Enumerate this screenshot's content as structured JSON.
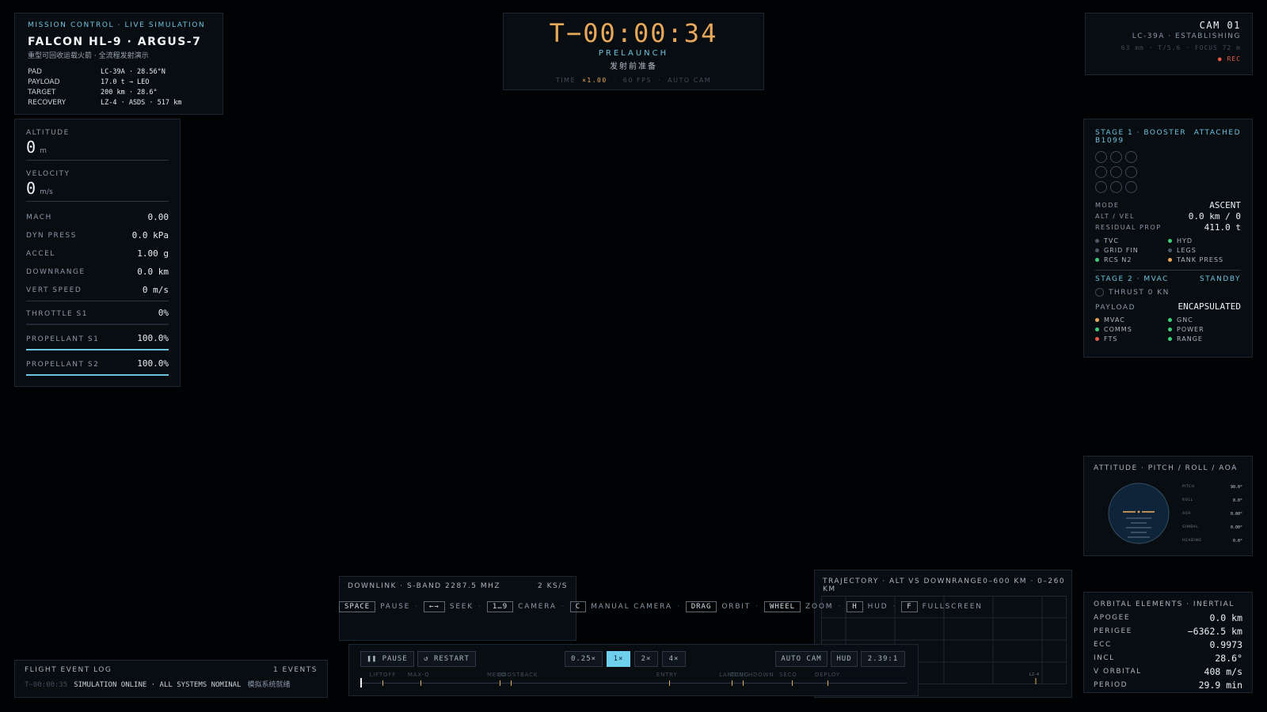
{
  "mission": {
    "header": "MISSION CONTROL · LIVE SIMULATION",
    "title": "FALCON HL-9 · ARGUS-7",
    "subtitle": "重型可回收运载火箭 · 全流程发射演示",
    "rows": [
      {
        "k": "PAD",
        "v": "LC-39A · 28.56°N"
      },
      {
        "k": "PAYLOAD",
        "v": "17.0 t → LEO"
      },
      {
        "k": "TARGET",
        "v": "200 km · 28.6°"
      },
      {
        "k": "RECOVERY",
        "v": "LZ-4 · ASDS · 517 km"
      }
    ]
  },
  "telemetry": {
    "altitude_label": "ALTITUDE",
    "altitude_value": "0",
    "altitude_unit": "m",
    "velocity_label": "VELOCITY",
    "velocity_value": "0",
    "velocity_unit": "m/s",
    "rows": [
      {
        "k": "MACH",
        "v": "0.00"
      },
      {
        "k": "DYN PRESS",
        "v": "0.0 kPa"
      },
      {
        "k": "ACCEL",
        "v": "1.00 g"
      },
      {
        "k": "DOWNRANGE",
        "v": "0.0 km"
      },
      {
        "k": "VERT SPEED",
        "v": "0 m/s"
      }
    ],
    "throttle_label": "THROTTLE S1",
    "throttle_value": "0%",
    "prop1_label": "PROPELLANT S1",
    "prop1_value": "100.0%",
    "prop1_level": 1.0,
    "prop2_label": "PROPELLANT S2",
    "prop2_value": "100.0%",
    "prop2_level": 1.0
  },
  "clock": {
    "time": "T−00:00:34",
    "phase": "PRELAUNCH",
    "phase_cn": "发射前准备",
    "time_label": "TIME",
    "time_scale": "×1.00",
    "fps": "60 FPS",
    "cam_mode": "AUTO CAM"
  },
  "camera": {
    "name": "CAM 01",
    "location": "LC-39A · ESTABLISHING",
    "specs": "63 mm · T/5.6 · FOCUS 72 m",
    "rec": "● REC"
  },
  "stage1": {
    "title": "STAGE 1 · BOOSTER B1099",
    "status": "ATTACHED",
    "rows": [
      {
        "k": "MODE",
        "v": "ASCENT"
      },
      {
        "k": "ALT / VEL",
        "v": "0.0 km / 0"
      },
      {
        "k": "RESIDUAL PROP",
        "v": "411.0 t"
      }
    ],
    "systems": [
      {
        "name": "TVC",
        "color": "#4b5866"
      },
      {
        "name": "HYD",
        "color": "#3ecf7a"
      },
      {
        "name": "GRID FIN",
        "color": "#4b5866"
      },
      {
        "name": "LEGS",
        "color": "#4b5866"
      },
      {
        "name": "RCS N2",
        "color": "#3ecf7a"
      },
      {
        "name": "TANK PRESS",
        "color": "#e8a85a"
      }
    ]
  },
  "stage2": {
    "title": "STAGE 2 · MVAC",
    "status": "STANDBY",
    "thrust": "THRUST 0 KN",
    "payload_label": "PAYLOAD",
    "payload_value": "ENCAPSULATED",
    "systems": [
      {
        "name": "MVAC",
        "color": "#e8a85a"
      },
      {
        "name": "GNC",
        "color": "#3ecf7a"
      },
      {
        "name": "COMMS",
        "color": "#3ecf7a"
      },
      {
        "name": "POWER",
        "color": "#3ecf7a"
      },
      {
        "name": "FTS",
        "color": "#e85a4a"
      },
      {
        "name": "RANGE",
        "color": "#3ecf7a"
      }
    ]
  },
  "attitude": {
    "title": "ATTITUDE · PITCH / ROLL / AOA",
    "rows": [
      {
        "k": "PITCH",
        "v": "90.0°"
      },
      {
        "k": "ROLL",
        "v": "0.0°"
      },
      {
        "k": "AOA",
        "v": "0.00°"
      },
      {
        "k": "GIMBAL",
        "v": "0.00°"
      },
      {
        "k": "HEADING",
        "v": "0.0°"
      }
    ]
  },
  "orbital": {
    "title": "ORBITAL ELEMENTS · INERTIAL",
    "rows": [
      {
        "k": "APOGEE",
        "v": "0.0 km"
      },
      {
        "k": "PERIGEE",
        "v": "−6362.5 km"
      },
      {
        "k": "ECC",
        "v": "0.9973"
      },
      {
        "k": "INCL",
        "v": "28.6°"
      },
      {
        "k": "V ORBITAL",
        "v": "408 m/s"
      },
      {
        "k": "PERIOD",
        "v": "29.9 min"
      }
    ]
  },
  "trajectory": {
    "title": "TRAJECTORY · ALT VS DOWNRANGE",
    "range": "0–600 KM · 0–260 KM",
    "marker": "LZ-4"
  },
  "downlink": {
    "title": "DOWNLINK · S-BAND 2287.5 MHZ",
    "rate": "2 KS/S"
  },
  "shortcuts": [
    {
      "key": "SPACE",
      "label": "PAUSE"
    },
    {
      "key": "←→",
      "label": "SEEK"
    },
    {
      "key": "1…9",
      "label": "CAMERA"
    },
    {
      "key": "C",
      "label": "MANUAL CAMERA"
    },
    {
      "key": "DRAG",
      "label": "ORBIT"
    },
    {
      "key": "WHEEL",
      "label": "ZOOM"
    },
    {
      "key": "H",
      "label": "HUD"
    },
    {
      "key": "F",
      "label": "FULLSCREEN"
    }
  ],
  "controls": {
    "pause": "❚❚ PAUSE",
    "restart": "↺ RESTART",
    "speeds": [
      "0.25×",
      "1×",
      "2×",
      "4×"
    ],
    "active_speed": "1×",
    "auto_cam": "AUTO CAM",
    "hud": "HUD",
    "aspect": "2.39:1"
  },
  "timeline": {
    "progress": 0.0,
    "events": [
      {
        "label": "LIFTOFF",
        "pos": 0.04
      },
      {
        "label": "MAX-Q",
        "pos": 0.11
      },
      {
        "label": "MECO",
        "pos": 0.255
      },
      {
        "label": "BOOSTBACK",
        "pos": 0.275
      },
      {
        "label": "ENTRY",
        "pos": 0.565
      },
      {
        "label": "LANDING",
        "pos": 0.68
      },
      {
        "label": "TOUCHDOWN",
        "pos": 0.7
      },
      {
        "label": "SECO",
        "pos": 0.79
      },
      {
        "label": "DEPLOY",
        "pos": 0.855
      }
    ]
  },
  "eventlog": {
    "title": "FLIGHT EVENT LOG",
    "count": "1 EVENTS",
    "entries": [
      {
        "time": "T−00:00:35",
        "text": "SIMULATION ONLINE · ALL SYSTEMS NOMINAL",
        "cn": "模拟系统就绪"
      }
    ]
  }
}
